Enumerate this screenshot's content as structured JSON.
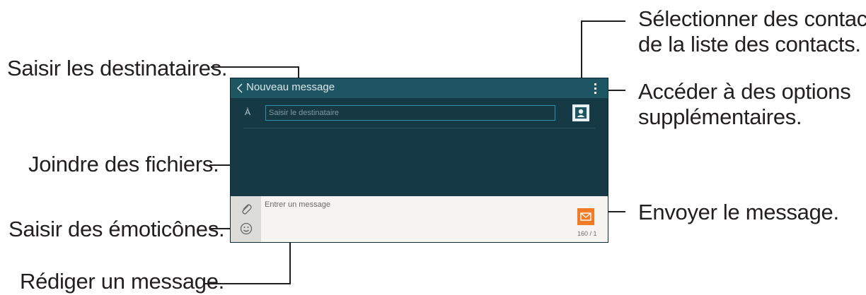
{
  "screen": {
    "title": "Nouveau message",
    "to_label": "À",
    "recipient_placeholder": "Saisir le destinataire",
    "message_placeholder": "Entrer un message",
    "char_counter": "160 / 1",
    "icons": [
      "back-icon",
      "more-options-icon",
      "contact-icon",
      "paperclip-icon",
      "emoticon-icon",
      "send-icon"
    ],
    "colors": {
      "action_bar": "#1e5562",
      "background": "#163a45",
      "field_border": "#2f93ad",
      "send_button": "#f27b27"
    }
  },
  "callouts": {
    "select_contacts_line1": "Sélectionner des contacts",
    "select_contacts_line2": "de la liste des contacts.",
    "more_options_line1": "Accéder à des options",
    "more_options_line2": "supplémentaires.",
    "recipients": "Saisir les destinataires.",
    "attach": "Joindre des fichiers.",
    "emoticons": "Saisir des émoticônes.",
    "send": "Envoyer le message.",
    "compose": "Rédiger un message."
  }
}
